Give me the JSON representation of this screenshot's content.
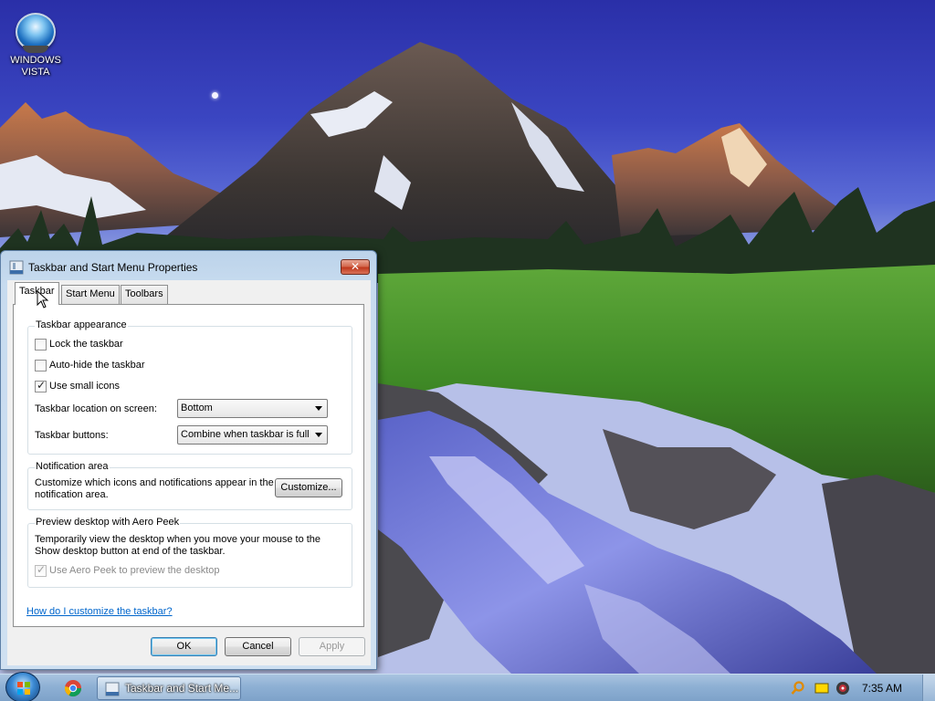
{
  "desktop": {
    "icons": [
      {
        "label": "WINDOWS VISTA",
        "icon": "windows-vista-disc-icon"
      }
    ],
    "wallpaper": "mountain-stream-landscape"
  },
  "dialog": {
    "title": "Taskbar and Start Menu Properties",
    "title_icon": "taskbar-properties-icon",
    "close_label": "✕",
    "tabs": [
      {
        "label": "Taskbar",
        "active": true
      },
      {
        "label": "Start Menu",
        "active": false
      },
      {
        "label": "Toolbars",
        "active": false
      }
    ],
    "taskbar_appearance": {
      "heading": "Taskbar appearance",
      "lock_taskbar": {
        "label": "Lock the taskbar",
        "checked": false
      },
      "auto_hide": {
        "label": "Auto-hide the taskbar",
        "checked": false
      },
      "small_icons": {
        "label": "Use small icons",
        "checked": true
      },
      "location_label": "Taskbar location on screen:",
      "location_value": "Bottom",
      "buttons_label": "Taskbar buttons:",
      "buttons_value": "Combine when taskbar is full"
    },
    "notification_area": {
      "heading": "Notification area",
      "description_line1": "Customize which icons and notifications appear in the",
      "description_line2": "notification area.",
      "customize_label": "Customize..."
    },
    "aero_peek": {
      "heading": "Preview desktop with Aero Peek",
      "description_line1": "Temporarily view the desktop when you move your mouse to the",
      "description_line2": "Show desktop button at end of the taskbar.",
      "use_aero_peek": {
        "label": "Use Aero Peek to preview the desktop",
        "checked": true,
        "disabled": true
      }
    },
    "help_link": "How do I customize the taskbar?",
    "buttons": {
      "ok": "OK",
      "cancel": "Cancel",
      "apply": "Apply"
    }
  },
  "taskbar": {
    "start_icon": "windows-start-orb",
    "pinned": [
      {
        "icon": "chrome-icon"
      }
    ],
    "active_task": {
      "label": "Taskbar and Start Me...",
      "icon": "taskbar-properties-icon"
    },
    "tray": [
      {
        "icon": "search-magnifier-icon",
        "color": "#e08a00"
      },
      {
        "icon": "yellow-note-icon",
        "color": "#ffd800"
      },
      {
        "icon": "record-disc-icon",
        "color": "#c0303a"
      }
    ],
    "clock": "7:35 AM"
  }
}
